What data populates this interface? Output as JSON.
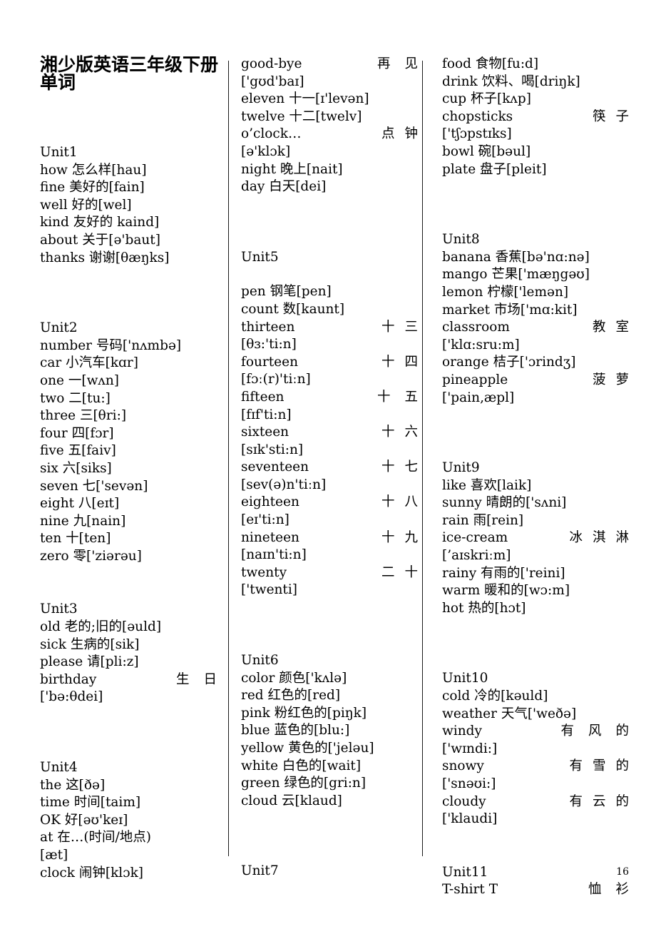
{
  "document": {
    "title": "湘少版英语三年级下册单词",
    "page_number": "16"
  },
  "columns": {
    "left": {
      "unit1_heading": "Unit1",
      "unit1": [
        "how 怎么样[hau]",
        "fine 美好的[fain]",
        "well 好的[wel]",
        "kind 友好的 kaind]",
        "about 关于[ə'baut]",
        "thanks 谢谢[θæŋks]"
      ],
      "unit2_heading": "Unit2",
      "unit2": [
        "number 号码['nʌmbə]",
        "car 小汽车[kɑr]",
        "one 一[wʌn]",
        "two 二[tu:]",
        "three 三[θri:]",
        "four 四[fɔr]",
        "five 五[faiv]",
        "six 六[siks]",
        "seven 七['sevən]",
        "eight 八[eɪt]",
        "nine 九[nain]",
        "ten 十[ten]",
        "zero 零['ziərəu]"
      ],
      "unit3_heading": "Unit3",
      "unit3": [
        "old 老的;旧的[əuld]",
        "sick 生病的[sik]",
        "please 请[pli:z]"
      ],
      "unit3_birthday_en": "birthday",
      "unit3_birthday_zh": "生日",
      "unit3_birthday_ipa": "['bə:θdei]",
      "unit4_heading": "Unit4",
      "unit4": [
        "the 这[ðə]",
        "time 时间[taim]",
        "OK 好[əʊ'keɪ]",
        "at 在…(时间/地点)",
        "[æt]",
        "clock 闹钟[klɔk]"
      ]
    },
    "middle": {
      "goodbye_en": "good-bye",
      "goodbye_zh": "再见",
      "goodbye_ipa": "['gʊd'baɪ]",
      "top_rest": [
        "eleven 十一[ɪ'levən]",
        "twelve 十二[twelv]"
      ],
      "oclock_en": "o’clock…",
      "oclock_zh": "点钟",
      "oclock_ipa": "[ə'klɔk]",
      "top_tail": [
        "night 晚上[nait]",
        "day 白天[dei]"
      ],
      "unit5_heading": "Unit5",
      "unit5_head": [
        "pen 钢笔[pen]",
        "count 数[kaunt]"
      ],
      "unit5_numbers": [
        {
          "en": "thirteen",
          "zh": "十三",
          "ipa": "[θɜ:'ti:n]"
        },
        {
          "en": "fourteen",
          "zh": "十四",
          "ipa": "[fɔː(r)'tiːn]"
        },
        {
          "en": "fifteen",
          "zh": "十五",
          "ipa": "[fɪf'ti:n]"
        },
        {
          "en": "sixteen",
          "zh": "十六",
          "ipa": "[sɪk'sti:n]"
        },
        {
          "en": "seventeen",
          "zh": "十七",
          "ipa": "[sev(ə)n'tiːn]"
        },
        {
          "en": "eighteen",
          "zh": "十八",
          "ipa": "[eɪ'ti:n]"
        },
        {
          "en": "nineteen",
          "zh": "十九",
          "ipa": "[naɪn'ti:n]"
        },
        {
          "en": "twenty",
          "zh": "二十",
          "ipa": "['twenti]"
        }
      ],
      "unit6_heading": "Unit6",
      "unit6": [
        "color 颜色['kʌlə]",
        "red 红色的[red]",
        "pink 粉红色的[piŋk]",
        "blue 蓝色的[blu:]",
        "yellow 黄色的['jeləu]",
        "white 白色的[wait]",
        "green 绿色的[gri:n]",
        "cloud 云[klaud]"
      ],
      "unit7_heading": "Unit7"
    },
    "right": {
      "top": [
        "food 食物[fu:d]",
        "drink 饮料、喝[driŋk]",
        "cup 杯子[kʌp]"
      ],
      "chopsticks_en": "chopsticks",
      "chopsticks_zh": "筷子",
      "chopsticks_ipa": "['tʃɔpstɪks]",
      "top_tail": [
        "bowl 碗[bəul]",
        "plate 盘子[pleit]"
      ],
      "unit8_heading": "Unit8",
      "unit8_head": [
        "banana 香蕉[bə'nɑ:nə]",
        "mango 芒果['mæŋgəʊ]",
        "lemon 柠檬['lemən]",
        "market 市场['mɑ:kit]"
      ],
      "classroom_en": "classroom",
      "classroom_zh": "教室",
      "classroom_ipa": "['klɑ:sru:m]",
      "unit8_orange": "orange 桔子['ɔrindʒ]",
      "pineapple_en": "pineapple",
      "pineapple_zh": "菠萝",
      "pineapple_ipa": "['pain‚æpl]",
      "unit9_heading": "Unit9",
      "unit9_head": [
        "like 喜欢[laik]",
        "sunny 晴朗的['sʌni]",
        "rain 雨[rein]"
      ],
      "icecream_en": "ice-cream",
      "icecream_zh": "冰淇淋",
      "icecream_ipa": "[’aɪskriːm]",
      "unit9_tail": [
        "rainy 有雨的['reini]",
        "warm 暖和的[wɔ:m]",
        "hot 热的[hɔt]"
      ],
      "unit10_heading": "Unit10",
      "unit10_head": [
        "cold 冷的[kəuld]",
        "weather 天气['weðə]"
      ],
      "windy_en": "windy",
      "windy_zh": "有风的",
      "windy_ipa": "['wɪndi:]",
      "snowy_en": "snowy",
      "snowy_zh": "有雪的",
      "snowy_ipa": "['snəʊi:]",
      "cloudy_en": "cloudy",
      "cloudy_zh": "有云的",
      "cloudy_ipa": "['klaudi]",
      "unit11_heading": "Unit11",
      "tshirt_en": "T-shirt T",
      "tshirt_zh": "恤衫"
    }
  }
}
